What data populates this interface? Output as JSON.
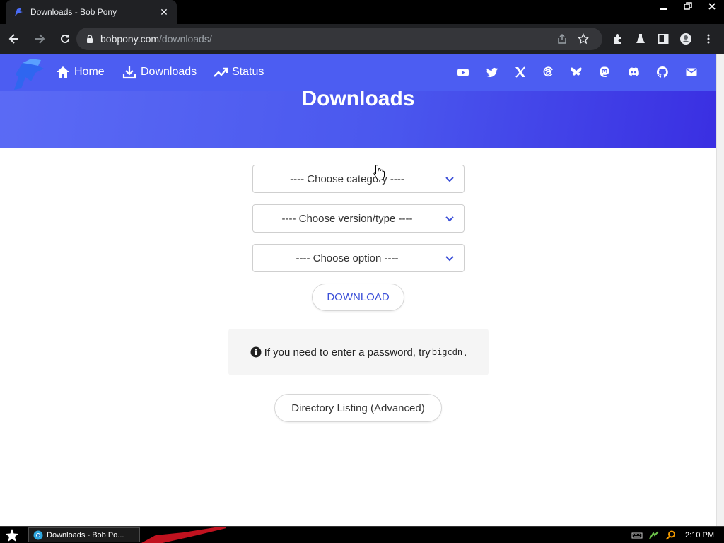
{
  "browser": {
    "tab_title": "Downloads - Bob Pony",
    "url_host": "bobpony.com",
    "url_path": "/downloads/"
  },
  "site": {
    "nav": [
      {
        "label": "Home",
        "icon": "home-icon"
      },
      {
        "label": "Downloads",
        "icon": "download-icon"
      },
      {
        "label": "Status",
        "icon": "trending-up-icon"
      }
    ],
    "social_icons": [
      "youtube-icon",
      "twitter-icon",
      "x-icon",
      "threads-icon",
      "bluesky-icon",
      "mastodon-icon",
      "discord-icon",
      "github-icon",
      "email-icon"
    ],
    "page_title": "Downloads"
  },
  "form": {
    "category_placeholder": "---- Choose category ----",
    "version_placeholder": "---- Choose version/type ----",
    "option_placeholder": "---- Choose option ----",
    "download_label": "DOWNLOAD"
  },
  "notice": {
    "text_before": "If you need to enter a password, try",
    "password": "bigcdn",
    "text_after": "."
  },
  "directory_button": "Directory Listing (Advanced)",
  "taskbar": {
    "window_title": "Downloads - Bob Po...",
    "clock": "2:10 PM"
  },
  "colors": {
    "brand_blue": "#4c5df2",
    "link_blue": "#3b4fd8",
    "chevron": "#3b4fd8"
  }
}
